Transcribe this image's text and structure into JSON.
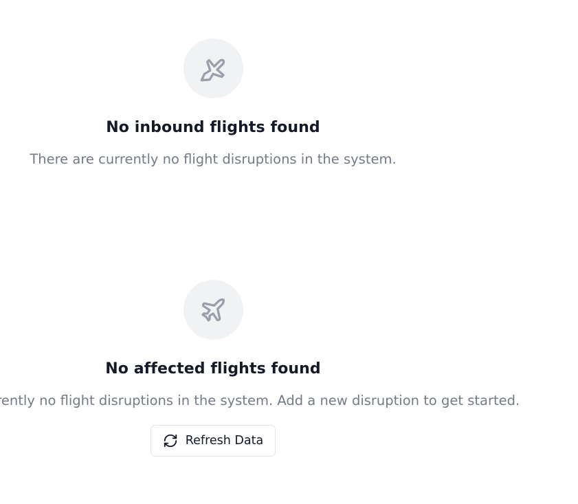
{
  "inbound": {
    "icon": "plane-landing-icon",
    "title": "No inbound flights found",
    "description": "There are currently no flight disruptions in the system."
  },
  "affected": {
    "icon": "plane-icon",
    "title": "No affected flights found",
    "description": "There are currently no flight disruptions in the system. Add a new disruption to get started.",
    "refresh_button": {
      "icon": "refresh-icon",
      "label": "Refresh Data"
    }
  }
}
